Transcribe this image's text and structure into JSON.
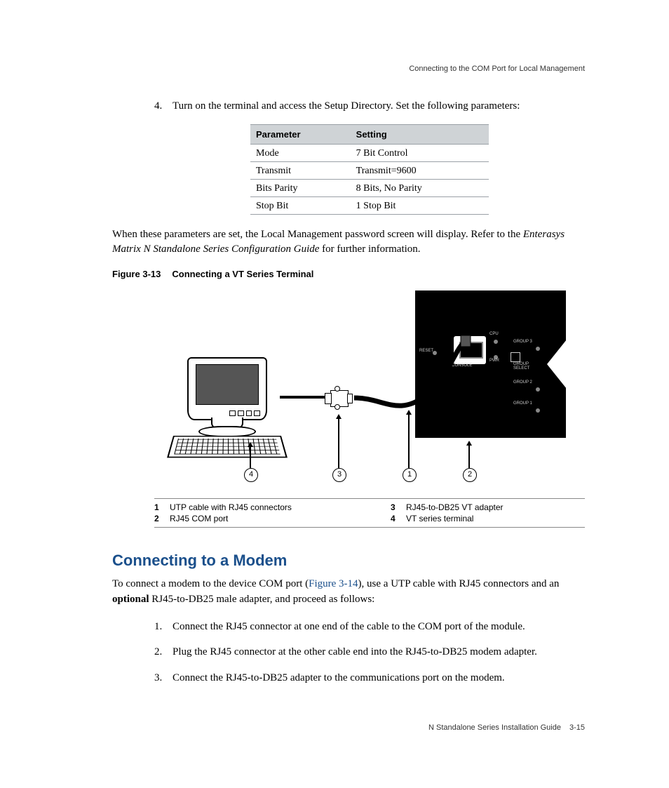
{
  "running_head": "Connecting to the COM Port for Local Management",
  "step4": {
    "num": "4.",
    "text": "Turn on the terminal and access the Setup Directory. Set the following parameters:"
  },
  "param_table": {
    "headers": {
      "col1": "Parameter",
      "col2": "Setting"
    },
    "rows": [
      {
        "param": "Mode",
        "setting": "7 Bit Control"
      },
      {
        "param": "Transmit",
        "setting": "Transmit=9600"
      },
      {
        "param": "Bits Parity",
        "setting": "8 Bits, No Parity"
      },
      {
        "param": "Stop Bit",
        "setting": "1 Stop Bit"
      }
    ]
  },
  "after_table_para": {
    "pre": "When these parameters are set, the Local Management password screen will display. Refer to the ",
    "italic": "Enterasys Matrix N Standalone Series Configuration Guide",
    "post": " for further information."
  },
  "figure": {
    "label": "Figure 3-13",
    "title": "Connecting a VT Series Terminal"
  },
  "device_labels": {
    "reset": "RESET",
    "console": "CONSOLE",
    "cpu": "CPU",
    "pwr": "PWR",
    "group_select": "GROUP\nSELECT",
    "group1": "GROUP 1",
    "group2": "GROUP 2",
    "group3": "GROUP 3"
  },
  "callouts": {
    "c1": "1",
    "c2": "2",
    "c3": "3",
    "c4": "4"
  },
  "legend": {
    "left": [
      {
        "n": "1",
        "t": "UTP cable with RJ45 connectors"
      },
      {
        "n": "2",
        "t": "RJ45 COM port"
      }
    ],
    "right": [
      {
        "n": "3",
        "t": "RJ45-to-DB25 VT adapter"
      },
      {
        "n": "4",
        "t": "VT series terminal"
      }
    ]
  },
  "section_heading": "Connecting to a Modem",
  "modem_intro": {
    "pre": "To connect a modem to the device COM port (",
    "link": "Figure 3-14",
    "mid": "), use a UTP cable with RJ45 connectors and an ",
    "bold": "optional",
    "post": " RJ45-to-DB25 male adapter, and proceed as follows:"
  },
  "modem_steps": [
    {
      "n": "1.",
      "t": "Connect the RJ45 connector at one end of the cable to the COM port of the module."
    },
    {
      "n": "2.",
      "t": "Plug the RJ45 connector at the other cable end into the RJ45-to-DB25 modem adapter."
    },
    {
      "n": "3.",
      "t": "Connect the RJ45-to-DB25 adapter to the communications port on the modem."
    }
  ],
  "footer": {
    "title": "N Standalone Series Installation Guide",
    "page": "3-15"
  }
}
